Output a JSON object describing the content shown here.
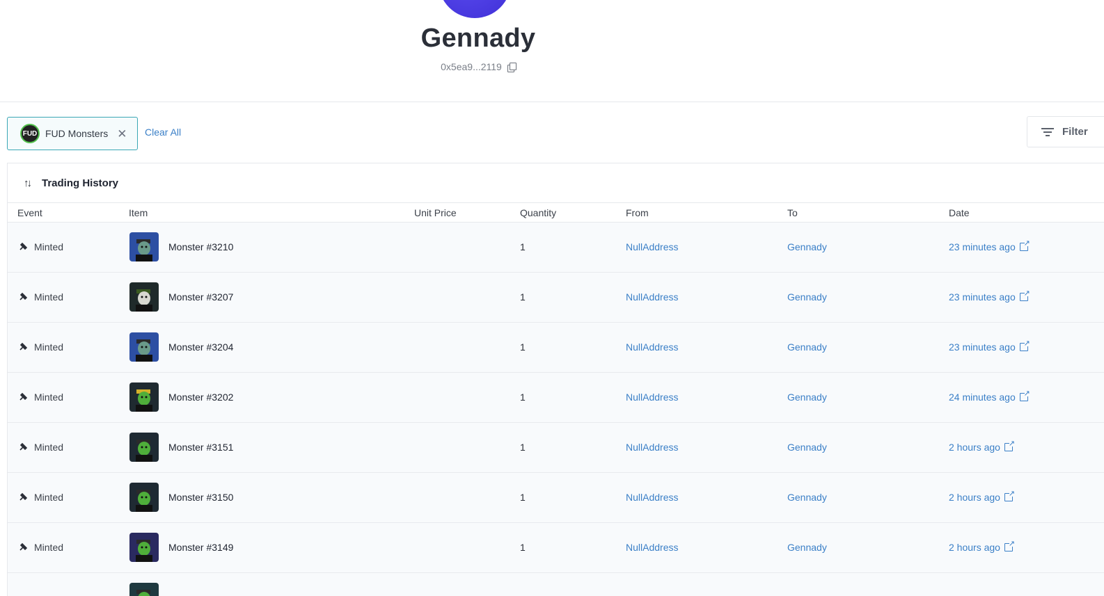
{
  "profile": {
    "name": "Gennady",
    "address": "0x5ea9...2119"
  },
  "filters": {
    "chip_label": "FUD Monsters",
    "chip_logo_text": "FUD",
    "clear_all": "Clear All",
    "filter_button": "Filter"
  },
  "history": {
    "title": "Trading History",
    "columns": [
      "Event",
      "Item",
      "Unit Price",
      "Quantity",
      "From",
      "To",
      "Date"
    ],
    "rows": [
      {
        "event": "Minted",
        "item": "Monster #3210",
        "price": "",
        "qty": "1",
        "from": "NullAddress",
        "to": "Gennady",
        "date": "23 minutes ago",
        "hat": "#2a2a2a",
        "bg": "#2d4fa3",
        "face": "#6a9a8a"
      },
      {
        "event": "Minted",
        "item": "Monster #3207",
        "price": "",
        "qty": "1",
        "from": "NullAddress",
        "to": "Gennady",
        "date": "23 minutes ago",
        "hat": "#3a5a20",
        "bg": "#1f2a2a",
        "face": "#d8d8d0"
      },
      {
        "event": "Minted",
        "item": "Monster #3204",
        "price": "",
        "qty": "1",
        "from": "NullAddress",
        "to": "Gennady",
        "date": "23 minutes ago",
        "hat": "#2a2a2a",
        "bg": "#2d4fa3",
        "face": "#6a9a8a"
      },
      {
        "event": "Minted",
        "item": "Monster #3202",
        "price": "",
        "qty": "1",
        "from": "NullAddress",
        "to": "Gennady",
        "date": "24 minutes ago",
        "hat": "#d4b02a",
        "bg": "#1f2a30",
        "face": "#4fae3a"
      },
      {
        "event": "Minted",
        "item": "Monster #3151",
        "price": "",
        "qty": "1",
        "from": "NullAddress",
        "to": "Gennady",
        "date": "2 hours ago",
        "hat": "#2a2a2a",
        "bg": "#1f2a33",
        "face": "#4fae3a"
      },
      {
        "event": "Minted",
        "item": "Monster #3150",
        "price": "",
        "qty": "1",
        "from": "NullAddress",
        "to": "Gennady",
        "date": "2 hours ago",
        "hat": "#2a2a2a",
        "bg": "#1f2a33",
        "face": "#4fae3a"
      },
      {
        "event": "Minted",
        "item": "Monster #3149",
        "price": "",
        "qty": "1",
        "from": "NullAddress",
        "to": "Gennady",
        "date": "2 hours ago",
        "hat": "#2a2a2a",
        "bg": "#2a2a60",
        "face": "#4fae3a"
      },
      {
        "event": "",
        "item": "",
        "price": "",
        "qty": "",
        "from": "",
        "to": "",
        "date": "",
        "hat": "#2a2a2a",
        "bg": "#1f3a40",
        "face": "#4fae3a"
      }
    ]
  },
  "icons": {
    "event_icon": "minted-icon",
    "date_link_icon": "external-link-icon",
    "copy_icon": "copy-icon",
    "trading_icon": "swap-arrows-icon"
  },
  "colors": {
    "link": "#3a7fc7",
    "chip_border": "#3aa7b5",
    "avatar": "#4a3ae6"
  }
}
